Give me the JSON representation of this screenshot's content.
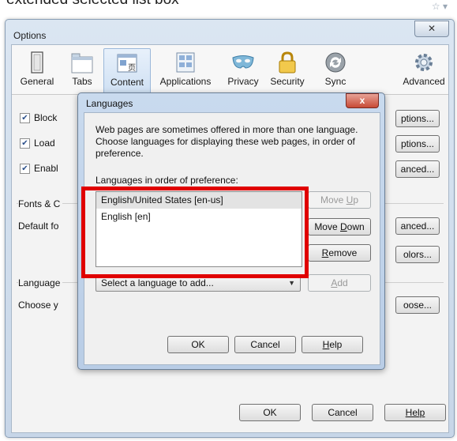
{
  "caption": "extended selected list box\"",
  "options_window": {
    "title": "Options",
    "close_glyph": "✕",
    "toolbar": [
      {
        "label": "General",
        "icon": "general-icon"
      },
      {
        "label": "Tabs",
        "icon": "tabs-icon"
      },
      {
        "label": "Content",
        "icon": "content-icon"
      },
      {
        "label": "Applications",
        "icon": "applications-icon"
      },
      {
        "label": "Privacy",
        "icon": "privacy-mask-icon"
      },
      {
        "label": "Security",
        "icon": "padlock-icon"
      },
      {
        "label": "Sync",
        "icon": "sync-icon"
      },
      {
        "label": "Advanced",
        "icon": "gear-icon"
      }
    ],
    "active_tab": "Content",
    "content": {
      "checkbox_block": "Block",
      "checkbox_load": "Load",
      "checkbox_enable": "Enabl",
      "options_btn_1": "ptions...",
      "options_btn_2": "ptions...",
      "advanced_btn_1": "anced...",
      "fonts_group": "Fonts & C",
      "default_font": "Default fo",
      "advanced_btn_2": "anced...",
      "colors_btn": "olors...",
      "languages_group": "Language",
      "choose_text": "Choose y",
      "choose_btn": "oose..."
    },
    "buttons": {
      "ok": "OK",
      "cancel": "Cancel",
      "help": "Help"
    }
  },
  "languages_dialog": {
    "title": "Languages",
    "close_glyph": "x",
    "description": "Web pages are sometimes offered in more than one language. Choose languages for displaying these web pages, in order of preference.",
    "list_label": "Languages in order of preference:",
    "languages": [
      "English/United States  [en-us]",
      "English  [en]"
    ],
    "select_placeholder": "Select a language to add...",
    "buttons": {
      "move_up": "Move Up",
      "move_down": "Move Down",
      "remove": "Remove",
      "add": "Add",
      "ok": "OK",
      "cancel": "Cancel",
      "help": "Help"
    }
  },
  "highlight_color": "#e00000"
}
